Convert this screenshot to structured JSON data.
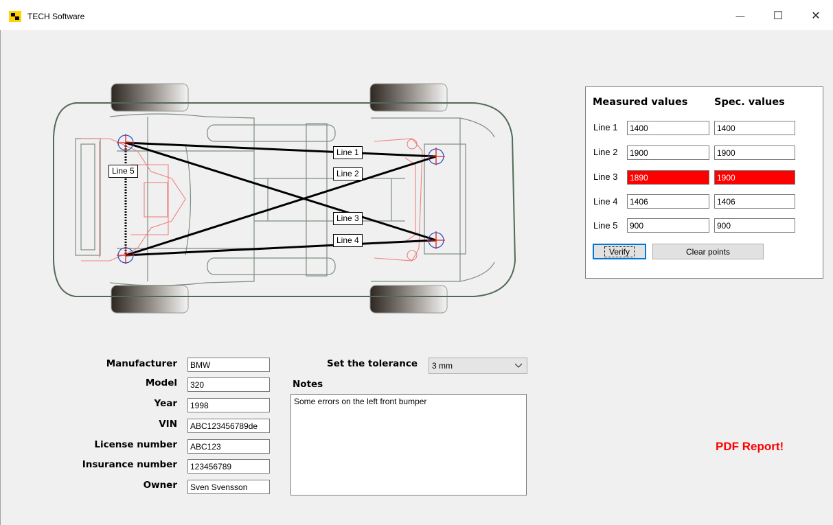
{
  "window": {
    "title": "TECH Software",
    "minimize_glyph": "—",
    "maximize_glyph": "☐",
    "close_glyph": "✕"
  },
  "diagram": {
    "lines": [
      {
        "label": "Line 1"
      },
      {
        "label": "Line 2"
      },
      {
        "label": "Line 3"
      },
      {
        "label": "Line 4"
      },
      {
        "label": "Line 5"
      }
    ]
  },
  "measurements": {
    "measured_header": "Measured values",
    "spec_header": "Spec. values",
    "rows": [
      {
        "label": "Line 1",
        "measured": "1400",
        "spec": "1400",
        "error": false
      },
      {
        "label": "Line 2",
        "measured": "1900",
        "spec": "1900",
        "error": false
      },
      {
        "label": "Line 3",
        "measured": "1890",
        "spec": "1900",
        "error": true
      },
      {
        "label": "Line 4",
        "measured": "1406",
        "spec": "1406",
        "error": false
      },
      {
        "label": "Line 5",
        "measured": "900",
        "spec": "900",
        "error": false
      }
    ],
    "verify_label": "Verify",
    "clear_label": "Clear points",
    "error_color": "#ff0000"
  },
  "vehicle": {
    "manufacturer_label": "Manufacturer",
    "manufacturer": "BMW",
    "model_label": "Model",
    "model": "320",
    "year_label": "Year",
    "year": "1998",
    "vin_label": "VIN",
    "vin": "ABC123456789de",
    "license_label": "License number",
    "license": "ABC123",
    "insurance_label": "Insurance number",
    "insurance": "123456789",
    "owner_label": "Owner",
    "owner": "Sven Svensson"
  },
  "tolerance": {
    "label": "Set the tolerance",
    "value": "3 mm"
  },
  "notes": {
    "label": "Notes",
    "text": "Some errors on the left front bumper"
  },
  "pdf_report_label": "PDF Report!",
  "colors": {
    "pdf_report": "#ff0000",
    "car_outline": "#4f6b57",
    "chassis_red": "#f08080"
  }
}
